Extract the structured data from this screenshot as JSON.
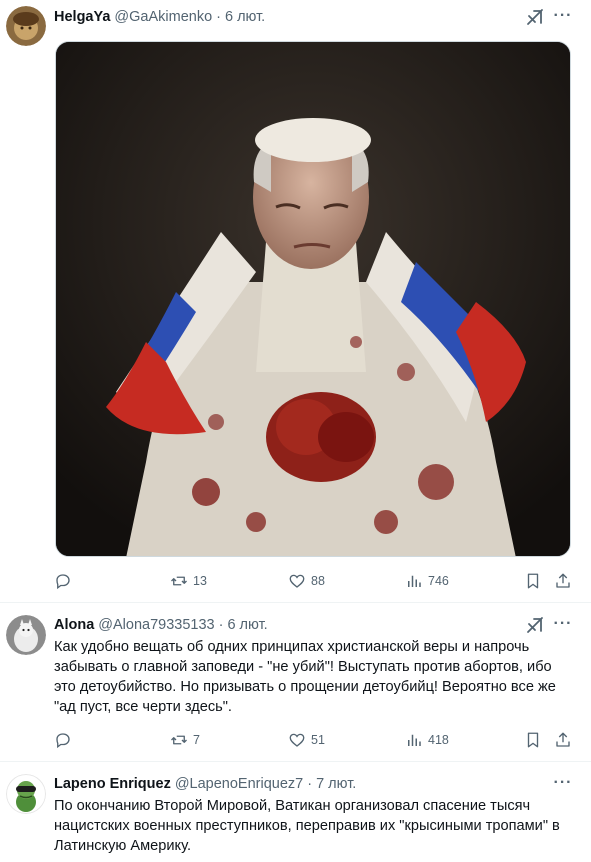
{
  "tweets": [
    {
      "author": "HelgaYa",
      "handle": "@GaAkimenko",
      "separator": "·",
      "time": "6 лют.",
      "replies": "",
      "reposts": "13",
      "likes": "88",
      "views": "746"
    },
    {
      "author": "Alona",
      "handle": "@Alona79335133",
      "separator": "·",
      "time": "6 лют.",
      "text": "Как удобно вещать об одних принципах христианской веры и напрочь забывать о главной заповеди - \"не убий\"! Выступать против абортов, ибо это детоубийство. Но призывать о прощении детоубийц! Вероятно все же \"ад пуст, все черти здесь\".",
      "replies": "",
      "reposts": "7",
      "likes": "51",
      "views": "418"
    },
    {
      "author": "Lapeno Enriquez",
      "handle": "@LapenoEnriquez7",
      "separator": "·",
      "time": "7 лют.",
      "text": "По окончанию Второй Мировой, Ватикан организовал спасение тысяч нацистских военных преступников, переправив их \"крысиными тропами\" в Латинскую Америку."
    }
  ],
  "icons": {
    "reply": "reply-icon",
    "repost": "repost-icon",
    "like": "like-icon",
    "views": "views-icon",
    "bookmark": "bookmark-icon",
    "share": "share-icon",
    "grok": "grok-icon",
    "more": "more-icon"
  },
  "colors": {
    "text": "#0f1419",
    "secondary": "#536471",
    "divider": "#eff3f4",
    "flag_white": "#e9e4dc",
    "flag_blue": "#2d4fb3",
    "flag_red": "#c62b22",
    "blood": "#7a1410"
  }
}
